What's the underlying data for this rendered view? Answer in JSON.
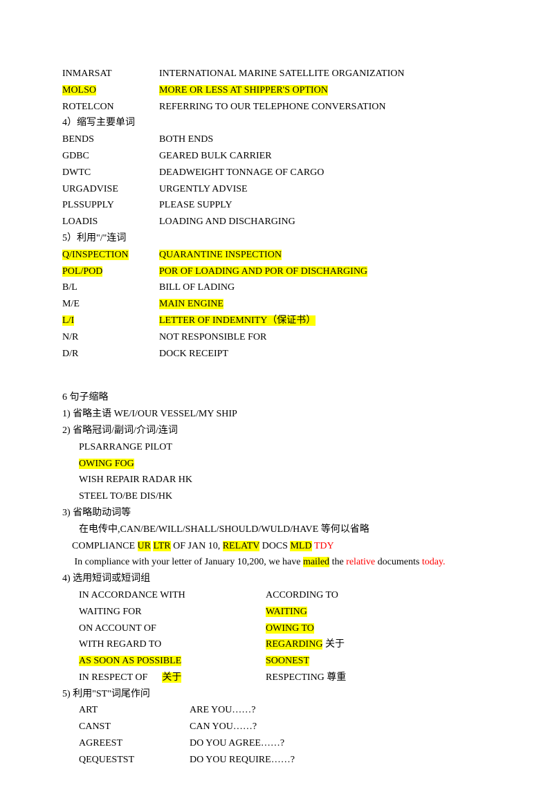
{
  "t1": [
    {
      "term": "INMARSAT",
      "sp": "",
      "def": "INTERNATIONAL MARINE SATELLITE ORGANIZATION",
      "thl": false,
      "dhl": false
    },
    {
      "term": "MOLSO",
      "sp": " ",
      "def": "MORE OR LESS AT SHIPPER'S OPTION",
      "thl": true,
      "dhl": true
    },
    {
      "term": "ROTELCON",
      "sp": " ",
      "def": "REFERRING TO OUR TELEPHONE CONVERSATION",
      "thl": false,
      "dhl": false
    }
  ],
  "h4": "4）缩写主要单词",
  "t2": [
    {
      "term": "BENDS",
      "sp": "",
      "def": "BOTH ENDS",
      "thl": false,
      "dhl": false
    },
    {
      "term": "GDBC",
      "sp": "",
      "def": "GEARED BULK CARRIER",
      "thl": false,
      "dhl": false
    },
    {
      "term": "DWTC",
      "sp": " ",
      "def": "DEADWEIGHT TONNAGE OF CARGO",
      "thl": false,
      "dhl": false
    },
    {
      "term": "URGADVISE",
      "sp": "",
      "def": "URGENTLY ADVISE",
      "thl": false,
      "dhl": false
    },
    {
      "term": "PLSSUPPLY",
      "sp": " ",
      "def": "PLEASE SUPPLY",
      "thl": false,
      "dhl": false
    },
    {
      "term": "LOADIS",
      "sp": "",
      "def": "LOADING AND DISCHARGING",
      "thl": false,
      "dhl": false
    }
  ],
  "h5": "5）利用\"/\"连词",
  "t3": [
    {
      "term": "Q/INSPECTION",
      "sp": "",
      "def": "QUARANTINE INSPECTION",
      "thl": true,
      "dhl": true
    },
    {
      "term": "POL/POD",
      "sp": " ",
      "def": "POR OF LOADING AND POR OF DISCHARGING",
      "thl": true,
      "dhl": true
    },
    {
      "term": "B/L",
      "sp": "",
      "def": "BILL OF LADING",
      "thl": false,
      "dhl": false
    },
    {
      "term": "M/E",
      "sp": " ",
      "def": "MAIN ENGINE",
      "thl": false,
      "dhl": true
    },
    {
      "term": "L/I",
      "sp": " ",
      "def": "LETTER OF INDEMNITY（保证书）",
      "thl": true,
      "dhl": true
    },
    {
      "term": "N/R",
      "sp": "",
      "def": "NOT RESPONSIBLE FOR",
      "thl": false,
      "dhl": false
    },
    {
      "term": "D/R",
      "sp": "",
      "def": "DOCK RECEIPT",
      "thl": false,
      "dhl": false
    }
  ],
  "h6": "6  句子缩略",
  "s1": "1)   省略主语 WE/I/OUR VESSEL/MY SHIP",
  "s2": "2)   省略冠词/副词/介词/连词",
  "s2a": "PLSARRANGE PILOT",
  "s2b": "OWING FOG",
  "s2c": "WISH REPAIR RADAR HK",
  "s2d": "STEEL TO/BE DIS/HK",
  "s3": "3)   省略助动词等",
  "s3a": "在电传中,CAN/BE/WILL/SHALL/SHOULD/WULD/HAVE 等何以省略",
  "comp": {
    "a": "    COMPLIANCE ",
    "b": "UR",
    "c": " ",
    "d": "LTR",
    "e": " OF JAN 10, ",
    "f": "RELATV",
    "g": " DOCS ",
    "h": "MLD",
    "i": " ",
    "j": "TDY"
  },
  "sent": {
    "a": "     In compliance with your letter of January 10,200, we have ",
    "b": "mailed",
    "c": " the ",
    "d": "relative",
    "e": " documents ",
    "f": "today."
  },
  "s4": "4)   选用短词或短词组",
  "t4": [
    {
      "l": "IN ACCORDANCE WITH",
      "r": "ACCORDING TO",
      "rhl": false,
      "lhl": false,
      "ex": ""
    },
    {
      "l": "WAITING FOR",
      "r": "WAITING",
      "rhl": true,
      "lhl": false,
      "ex": ""
    },
    {
      "l": "ON ACCOUNT OF",
      "r": "OWING TO",
      "rhl": true,
      "lhl": false,
      "ex": ""
    },
    {
      "l": "WITH REGARD TO",
      "r": "REGARDING",
      "rhl": true,
      "lhl": false,
      "ex": "   关于"
    },
    {
      "l": "AS SOON AS POSSIBLE",
      "r": "SOONEST",
      "rhl": true,
      "lhl": true,
      "ex": ""
    }
  ],
  "respL1": "IN RESPECT OF      ",
  "respL2": "关于",
  "respR": "RESPECTING 尊重",
  "s5": "5)   利用\"ST\"词尾作问",
  "t5": [
    {
      "l": "ART",
      "r": "ARE YOU……?"
    },
    {
      "l": "CANST",
      "r": "CAN YOU……?"
    },
    {
      "l": "AGREEST",
      "r": "DO YOU AGREE……?"
    },
    {
      "l": "QEQUESTST",
      "r": "DO YOU REQUIRE……?"
    }
  ]
}
